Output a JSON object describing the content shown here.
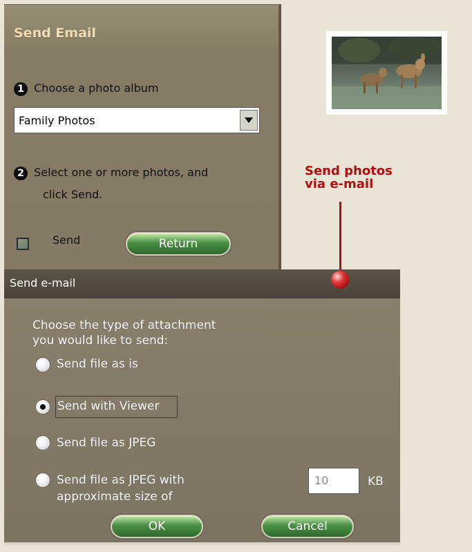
{
  "panel": {
    "title": "Send Email",
    "step1": {
      "num": "1",
      "label": "Choose a photo album"
    },
    "album_select": {
      "value": "Family Photos"
    },
    "step2": {
      "num": "2",
      "line1": "Select one or more photos, and",
      "line2": "click Send."
    },
    "send_checkbox_label": "Send",
    "return_button": "Return"
  },
  "callout": {
    "line1": "Send photos",
    "line2": "via e-mail"
  },
  "dialog": {
    "title": "Send e-mail",
    "prompt_line1": "Choose the type of attachment",
    "prompt_line2": "you would like to send:",
    "options": [
      {
        "label": "Send file as is",
        "selected": false
      },
      {
        "label": "Send with Viewer",
        "selected": true
      },
      {
        "label": "Send file as JPEG",
        "selected": false
      },
      {
        "label_line1": "Send file as JPEG with",
        "label_line2": "approximate size of",
        "selected": false
      }
    ],
    "size_value": "10",
    "size_unit": "KB",
    "ok_button": "OK",
    "cancel_button": "Cancel"
  },
  "colors": {
    "callout": "#b40d0d",
    "panel": "#8a8068",
    "title": "#f2ddb0"
  }
}
